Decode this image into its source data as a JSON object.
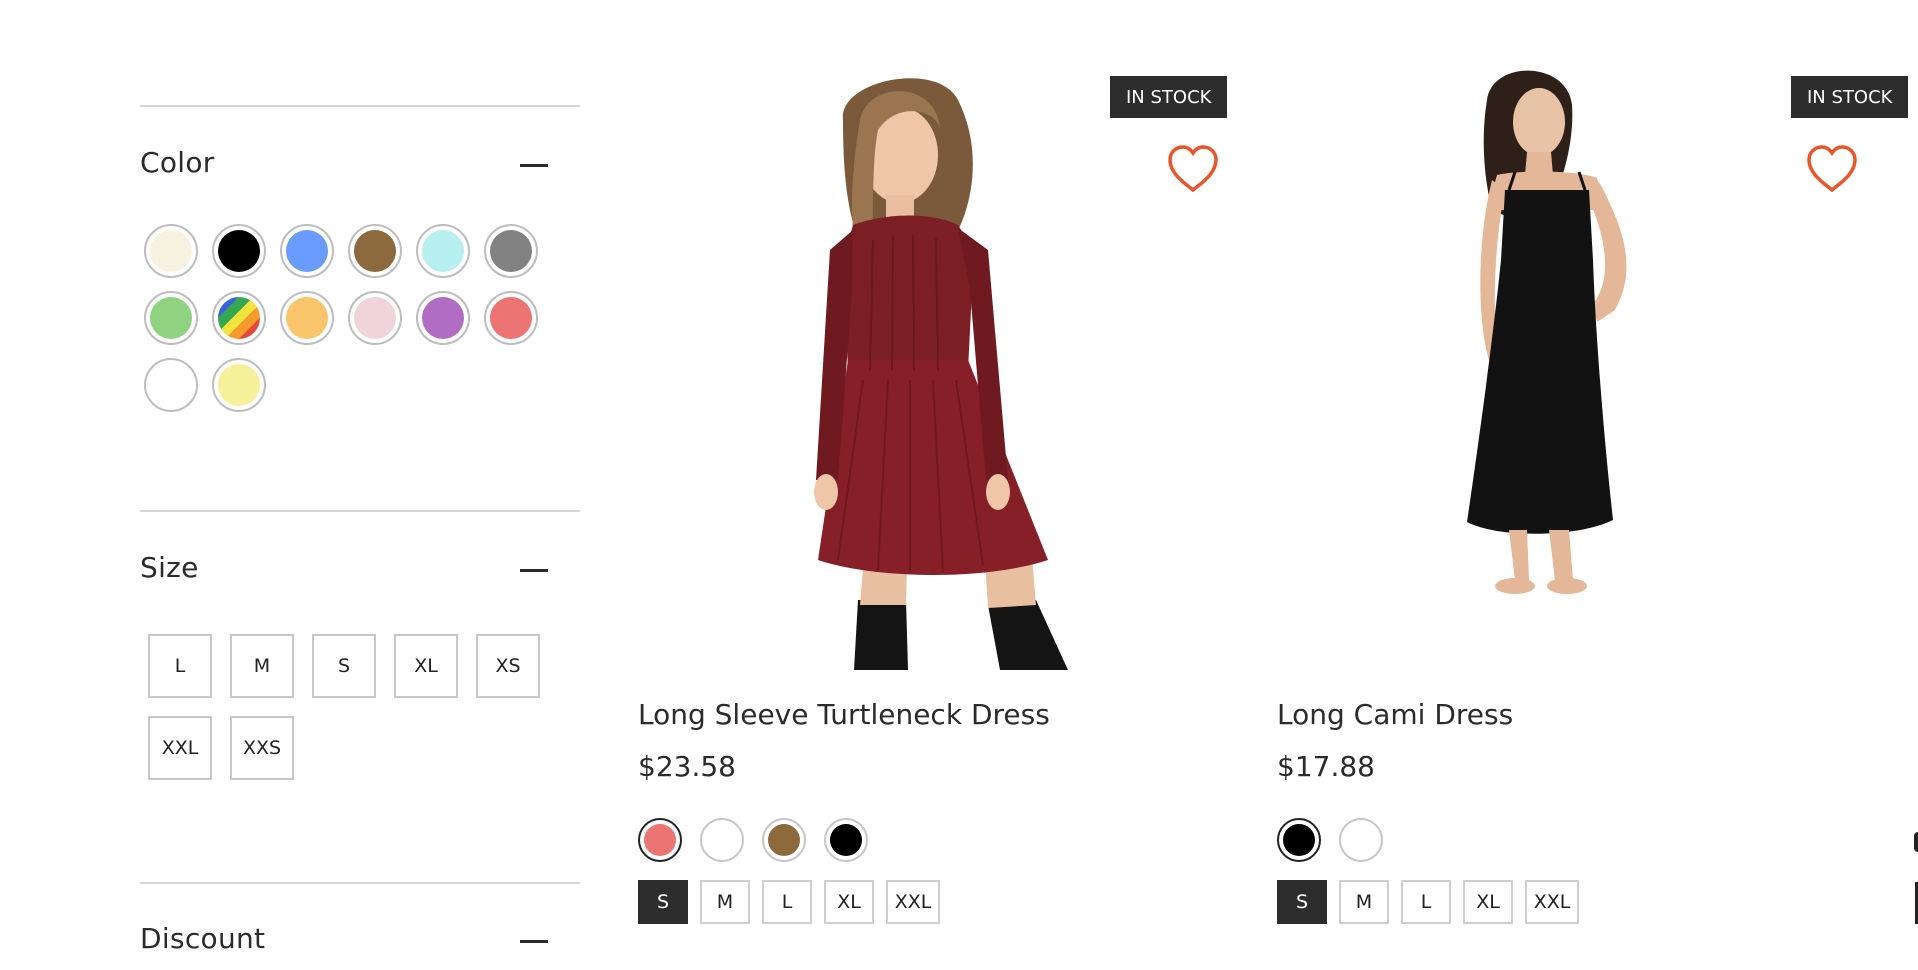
{
  "filters": {
    "color": {
      "title": "Color",
      "swatches": [
        {
          "name": "cream",
          "hex": "#f5f3df"
        },
        {
          "name": "black",
          "hex": "#000000"
        },
        {
          "name": "blue",
          "hex": "#6a9bff"
        },
        {
          "name": "brown",
          "hex": "#8c6a3d"
        },
        {
          "name": "light-cyan",
          "hex": "#b8eff0"
        },
        {
          "name": "gray",
          "hex": "#828282"
        },
        {
          "name": "green",
          "hex": "#8fd382"
        },
        {
          "name": "multicolor",
          "hex": "multi"
        },
        {
          "name": "orange",
          "hex": "#f9c46a"
        },
        {
          "name": "pink",
          "hex": "#f0d4dc"
        },
        {
          "name": "purple",
          "hex": "#b06dc3"
        },
        {
          "name": "red",
          "hex": "#ec7473"
        },
        {
          "name": "white",
          "hex": "#ffffff"
        },
        {
          "name": "yellow",
          "hex": "#f4f19a"
        }
      ]
    },
    "size": {
      "title": "Size",
      "options": [
        "L",
        "M",
        "S",
        "XL",
        "XS",
        "XXL",
        "XXS"
      ]
    },
    "discount": {
      "title": "Discount"
    }
  },
  "products": [
    {
      "badge": "IN STOCK",
      "name": "Long Sleeve Turtleneck Dress",
      "price": "$23.58",
      "image": "red-knit-dress-photo",
      "colors": [
        "#ec7473",
        "#ffffff",
        "#8c6a3d",
        "#000000"
      ],
      "selected_color": 0,
      "sizes": [
        "S",
        "M",
        "L",
        "XL",
        "XXL"
      ],
      "selected_size": "S"
    },
    {
      "badge": "IN STOCK",
      "name": "Long Cami Dress",
      "price": "$17.88",
      "image": "black-cami-dress-photo",
      "colors": [
        "#000000",
        "#ffffff"
      ],
      "selected_color": 0,
      "sizes": [
        "S",
        "M",
        "L",
        "XL",
        "XXL"
      ],
      "selected_size": "S"
    }
  ],
  "icons": {
    "wishlist": "heart-outline-icon",
    "collapse": "minus-icon"
  },
  "colors": {
    "heart": "#e8552b",
    "badge_bg": "#2d2d2d",
    "selected_size_bg": "#2d2d2d"
  }
}
